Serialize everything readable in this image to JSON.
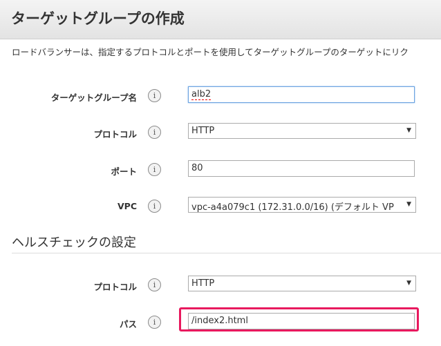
{
  "header": {
    "title": "ターゲットグループの作成"
  },
  "intro": "ロードバランサーは、指定するプロトコルとポートを使用してターゲットグループのターゲットにリク",
  "info_glyph": "i",
  "fields": {
    "target_group_name": {
      "label": "ターゲットグループ名",
      "value": "alb2"
    },
    "protocol": {
      "label": "プロトコル",
      "value": "HTTP"
    },
    "port": {
      "label": "ポート",
      "value": "80"
    },
    "vpc": {
      "label": "VPC",
      "value": "vpc-a4a079c1 (172.31.0.0/16) (デフォルト VP"
    }
  },
  "health_check": {
    "title": "ヘルスチェックの設定",
    "protocol": {
      "label": "プロトコル",
      "value": "HTTP"
    },
    "path": {
      "label": "パス",
      "value": "/index2.html"
    }
  },
  "colors": {
    "highlight": "#e8195e",
    "focus_border": "#6aa2e0"
  }
}
